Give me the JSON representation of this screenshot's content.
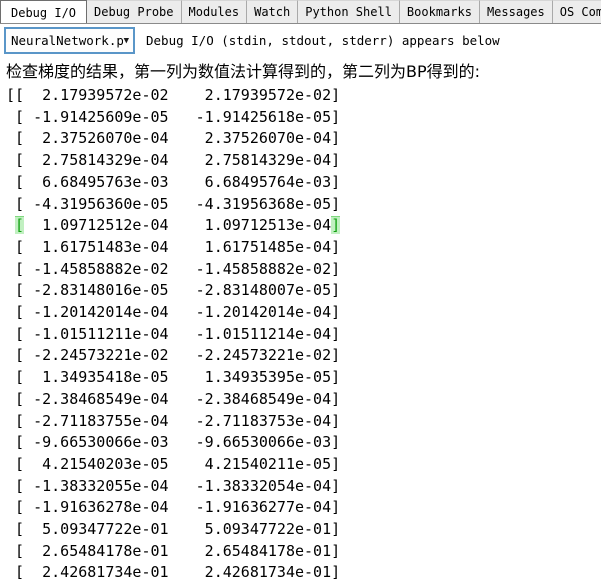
{
  "tabs": [
    {
      "label": "Debug I/O",
      "active": true
    },
    {
      "label": "Debug Probe",
      "active": false
    },
    {
      "label": "Modules",
      "active": false
    },
    {
      "label": "Watch",
      "active": false
    },
    {
      "label": "Python Shell",
      "active": false
    },
    {
      "label": "Bookmarks",
      "active": false
    },
    {
      "label": "Messages",
      "active": false
    },
    {
      "label": "OS Commands",
      "active": false
    }
  ],
  "toolbar": {
    "process_selector_label": "NeuralNetwork.py (j",
    "dropdown_arrow": "▼",
    "caption": "Debug I/O (stdin, stdout, stderr) appears below"
  },
  "output": {
    "header": "检查梯度的结果，第一列为数值法计算得到的，第二列为BP得到的:",
    "rows": [
      {
        "open": "[[",
        "col1": "  2.17939572e-02",
        "col2": "  2.17939572e-02",
        "close": "]",
        "highlight": false
      },
      {
        "open": " [",
        "col1": " -1.91425609e-05",
        "col2": " -1.91425618e-05",
        "close": "]",
        "highlight": false
      },
      {
        "open": " [",
        "col1": "  2.37526070e-04",
        "col2": "  2.37526070e-04",
        "close": "]",
        "highlight": false
      },
      {
        "open": " [",
        "col1": "  2.75814329e-04",
        "col2": "  2.75814329e-04",
        "close": "]",
        "highlight": false
      },
      {
        "open": " [",
        "col1": "  6.68495763e-03",
        "col2": "  6.68495764e-03",
        "close": "]",
        "highlight": false
      },
      {
        "open": " [",
        "col1": " -4.31956360e-05",
        "col2": " -4.31956368e-05",
        "close": "]",
        "highlight": false
      },
      {
        "open": " [",
        "col1": "  1.09712512e-04",
        "col2": "  1.09712513e-04",
        "close": "]",
        "highlight": true
      },
      {
        "open": " [",
        "col1": "  1.61751483e-04",
        "col2": "  1.61751485e-04",
        "close": "]",
        "highlight": false
      },
      {
        "open": " [",
        "col1": " -1.45858882e-02",
        "col2": " -1.45858882e-02",
        "close": "]",
        "highlight": false
      },
      {
        "open": " [",
        "col1": " -2.83148016e-05",
        "col2": " -2.83148007e-05",
        "close": "]",
        "highlight": false
      },
      {
        "open": " [",
        "col1": " -1.20142014e-04",
        "col2": " -1.20142014e-04",
        "close": "]",
        "highlight": false
      },
      {
        "open": " [",
        "col1": " -1.01511211e-04",
        "col2": " -1.01511214e-04",
        "close": "]",
        "highlight": false
      },
      {
        "open": " [",
        "col1": " -2.24573221e-02",
        "col2": " -2.24573221e-02",
        "close": "]",
        "highlight": false
      },
      {
        "open": " [",
        "col1": "  1.34935418e-05",
        "col2": "  1.34935395e-05",
        "close": "]",
        "highlight": false
      },
      {
        "open": " [",
        "col1": " -2.38468549e-04",
        "col2": " -2.38468549e-04",
        "close": "]",
        "highlight": false
      },
      {
        "open": " [",
        "col1": " -2.71183755e-04",
        "col2": " -2.71183753e-04",
        "close": "]",
        "highlight": false
      },
      {
        "open": " [",
        "col1": " -9.66530066e-03",
        "col2": " -9.66530066e-03",
        "close": "]",
        "highlight": false
      },
      {
        "open": " [",
        "col1": "  4.21540203e-05",
        "col2": "  4.21540211e-05",
        "close": "]",
        "highlight": false
      },
      {
        "open": " [",
        "col1": " -1.38332055e-04",
        "col2": " -1.38332054e-04",
        "close": "]",
        "highlight": false
      },
      {
        "open": " [",
        "col1": " -1.91636278e-04",
        "col2": " -1.91636277e-04",
        "close": "]",
        "highlight": false
      },
      {
        "open": " [",
        "col1": "  5.09347722e-01",
        "col2": "  5.09347722e-01",
        "close": "]",
        "highlight": false
      },
      {
        "open": " [",
        "col1": "  2.65484178e-01",
        "col2": "  2.65484178e-01",
        "close": "]",
        "highlight": false
      },
      {
        "open": " [",
        "col1": "  2.42681734e-01",
        "col2": "  2.42681734e-01",
        "close": "]",
        "highlight": false
      }
    ]
  },
  "colors": {
    "dropdown_border": "#5a96c8",
    "bracket_highlight_bg": "#c1f0c1",
    "bracket_highlight_fg": "#12a012",
    "tab_inactive_bg": "#ececec",
    "tab_active_bg": "#ffffff"
  }
}
